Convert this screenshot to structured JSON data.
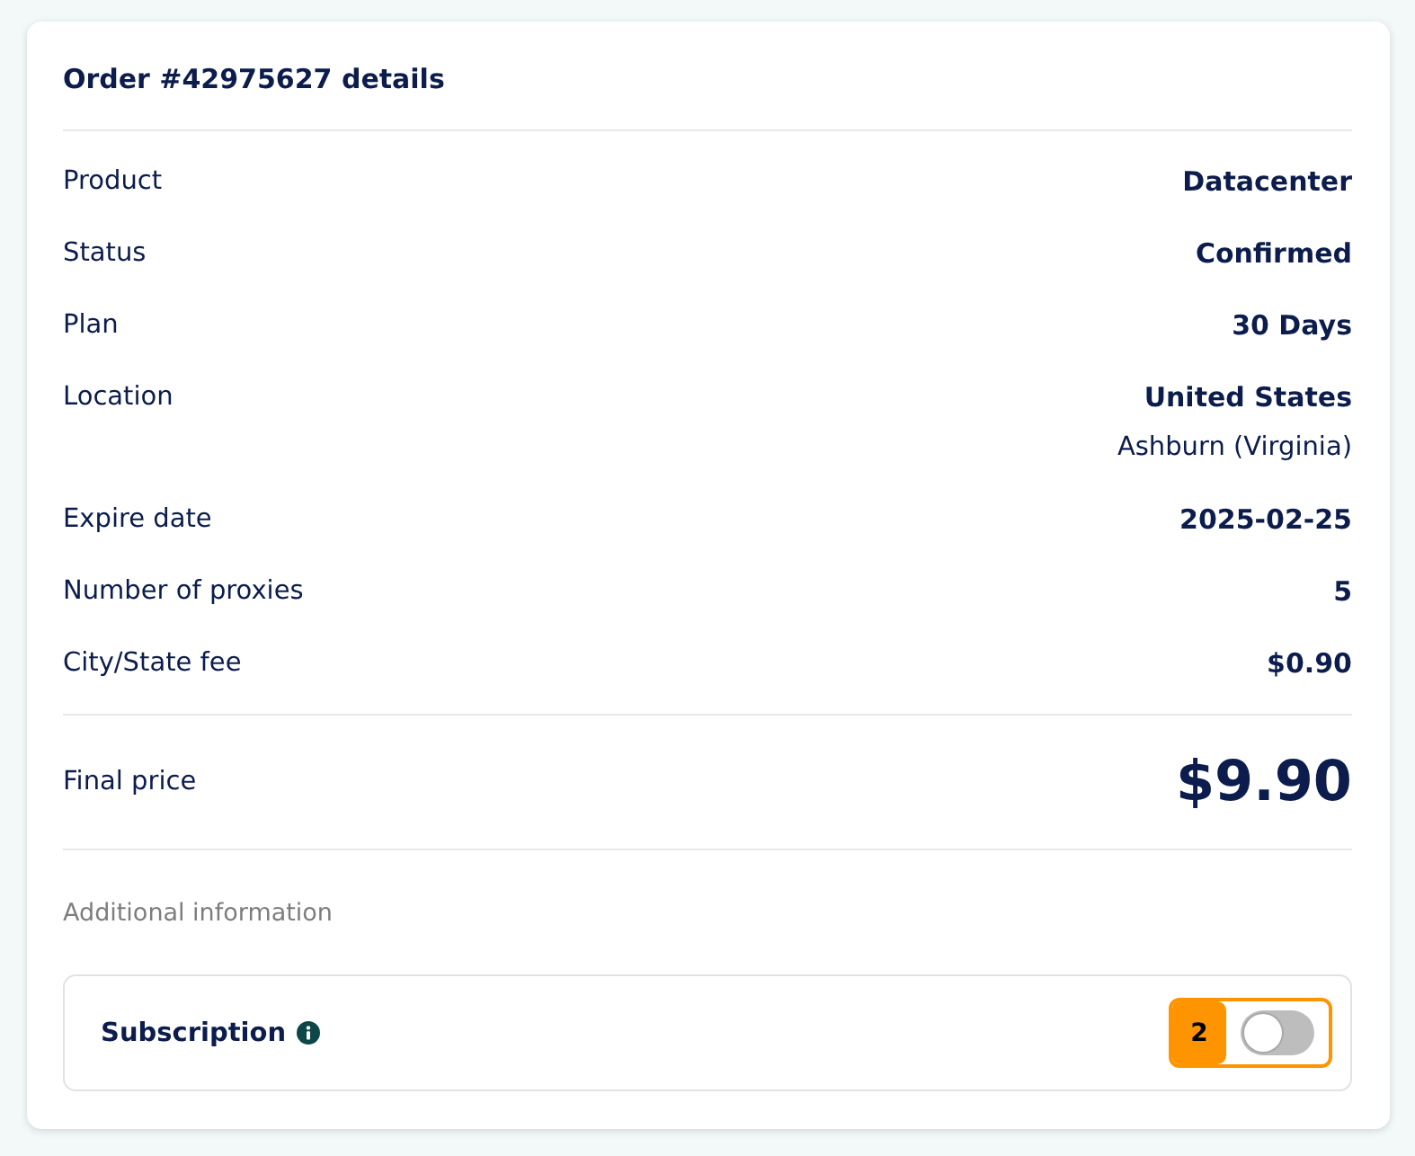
{
  "order": {
    "title": "Order #42975627 details"
  },
  "rows": [
    {
      "label": "Product",
      "value": "Datacenter"
    },
    {
      "label": "Status",
      "value": "Confirmed"
    },
    {
      "label": "Plan",
      "value": "30 Days"
    },
    {
      "label": "Location",
      "value": "United States",
      "detail": "Ashburn (Virginia)"
    },
    {
      "label": "Expire date",
      "value": "2025-02-25"
    },
    {
      "label": "Number of proxies",
      "value": "5"
    },
    {
      "label": "City/State fee",
      "value": "$0.90"
    }
  ],
  "final_price": {
    "label": "Final price",
    "value": "$9.90"
  },
  "additional": {
    "heading": "Additional information",
    "subscription": {
      "label": "Subscription",
      "badge": "2",
      "on": false
    }
  }
}
